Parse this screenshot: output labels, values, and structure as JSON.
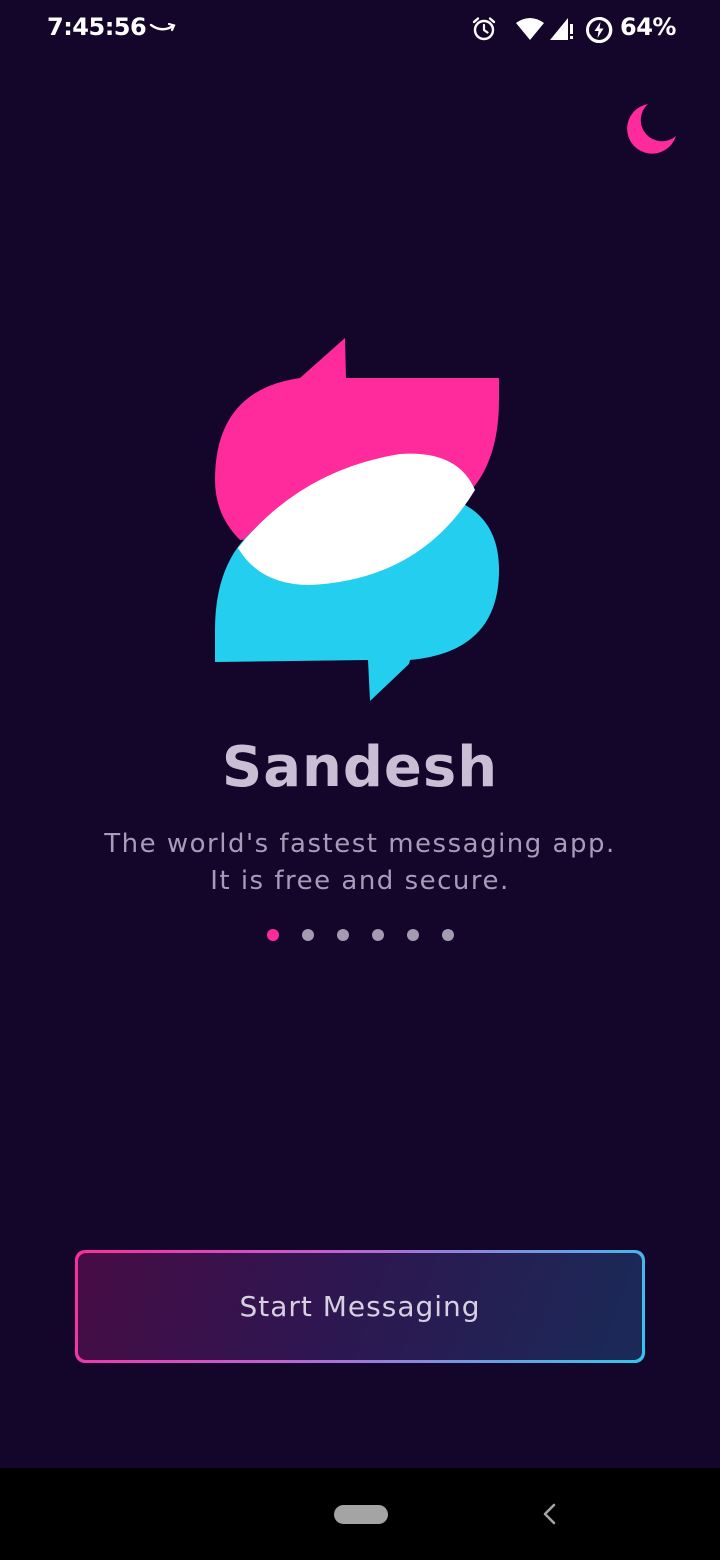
{
  "status_bar": {
    "time": "7:45:56",
    "battery_percent": "64%",
    "icons": [
      "amazon-smile-icon",
      "alarm-icon",
      "wifi-icon",
      "signal-icon",
      "battery-charging-icon"
    ]
  },
  "theme_toggle": {
    "icon": "moon-icon",
    "color": "#ff2a9c"
  },
  "logo": {
    "icon": "chat-bubbles-logo",
    "colors": {
      "pink": "#ff2a9c",
      "cyan": "#24ceee",
      "white": "#ffffff"
    }
  },
  "app": {
    "title": "Sandesh",
    "tagline_line1": "The world's fastest messaging app.",
    "tagline_line2": "It is free and secure."
  },
  "pager": {
    "count": 6,
    "active_index": 0
  },
  "start_button": {
    "label": "Start Messaging"
  },
  "nav_bar": {
    "icons": [
      "home-pill-icon",
      "back-chevron-icon"
    ]
  },
  "colors": {
    "background": "#14052b",
    "accent_pink": "#ff2a9c",
    "accent_cyan": "#24ceee"
  }
}
